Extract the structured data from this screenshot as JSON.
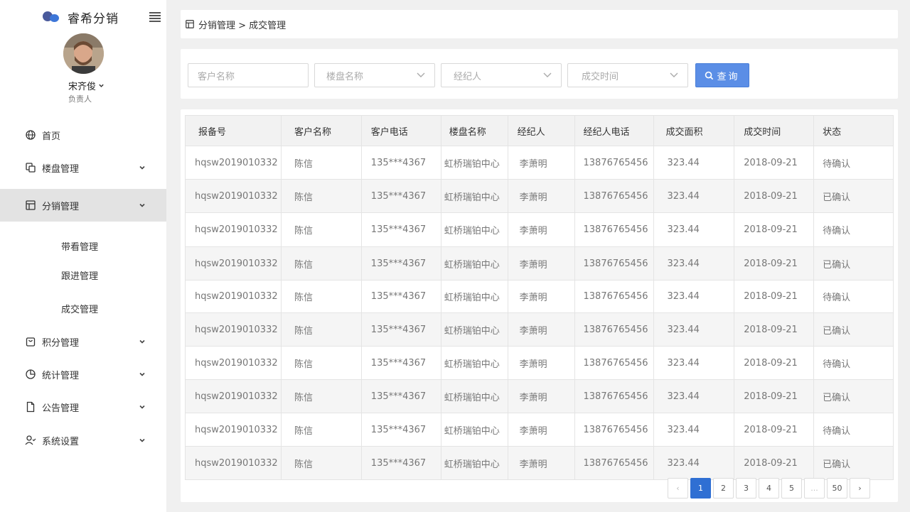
{
  "brand": {
    "name": "睿希分销"
  },
  "user": {
    "name": "宋齐俊",
    "role": "负责人"
  },
  "nav": {
    "home": "首页",
    "property": "楼盘管理",
    "distribution": "分销管理",
    "sub": {
      "viewing": "带看管理",
      "followup": "跟进管理",
      "deal": "成交管理"
    },
    "points": "积分管理",
    "stats": "统计管理",
    "notice": "公告管理",
    "settings": "系统设置"
  },
  "breadcrumb": {
    "text": "分销管理 > 成交管理"
  },
  "filters": {
    "customer_placeholder": "客户名称",
    "property_placeholder": "楼盘名称",
    "agent_placeholder": "经纪人",
    "date_placeholder": "成交时间",
    "search_label": "查询"
  },
  "table": {
    "headers": [
      "报备号",
      "客户名称",
      "客户电话",
      "楼盘名称",
      "经纪人",
      "经纪人电话",
      "成交面积",
      "成交时间",
      "状态"
    ],
    "rows": [
      [
        "hqsw2019010332",
        "陈信",
        "135***4367",
        "虹桥瑞铂中心",
        "李萧明",
        "13876765456",
        "323.44",
        "2018-09-21",
        "待确认"
      ],
      [
        "hqsw2019010332",
        "陈信",
        "135***4367",
        "虹桥瑞铂中心",
        "李萧明",
        "13876765456",
        "323.44",
        "2018-09-21",
        "已确认"
      ],
      [
        "hqsw2019010332",
        "陈信",
        "135***4367",
        "虹桥瑞铂中心",
        "李萧明",
        "13876765456",
        "323.44",
        "2018-09-21",
        "待确认"
      ],
      [
        "hqsw2019010332",
        "陈信",
        "135***4367",
        "虹桥瑞铂中心",
        "李萧明",
        "13876765456",
        "323.44",
        "2018-09-21",
        "已确认"
      ],
      [
        "hqsw2019010332",
        "陈信",
        "135***4367",
        "虹桥瑞铂中心",
        "李萧明",
        "13876765456",
        "323.44",
        "2018-09-21",
        "待确认"
      ],
      [
        "hqsw2019010332",
        "陈信",
        "135***4367",
        "虹桥瑞铂中心",
        "李萧明",
        "13876765456",
        "323.44",
        "2018-09-21",
        "已确认"
      ],
      [
        "hqsw2019010332",
        "陈信",
        "135***4367",
        "虹桥瑞铂中心",
        "李萧明",
        "13876765456",
        "323.44",
        "2018-09-21",
        "待确认"
      ],
      [
        "hqsw2019010332",
        "陈信",
        "135***4367",
        "虹桥瑞铂中心",
        "李萧明",
        "13876765456",
        "323.44",
        "2018-09-21",
        "已确认"
      ],
      [
        "hqsw2019010332",
        "陈信",
        "135***4367",
        "虹桥瑞铂中心",
        "李萧明",
        "13876765456",
        "323.44",
        "2018-09-21",
        "待确认"
      ],
      [
        "hqsw2019010332",
        "陈信",
        "135***4367",
        "虹桥瑞铂中心",
        "李萧明",
        "13876765456",
        "323.44",
        "2018-09-21",
        "已确认"
      ]
    ]
  },
  "status_colors": {
    "pending": "#2b5fc5",
    "confirmed": "#888888"
  },
  "accent_color": "#2f6fd3",
  "pagination": {
    "pages": [
      "1",
      "2",
      "3",
      "4",
      "5",
      "...",
      "50"
    ],
    "current": "1"
  }
}
